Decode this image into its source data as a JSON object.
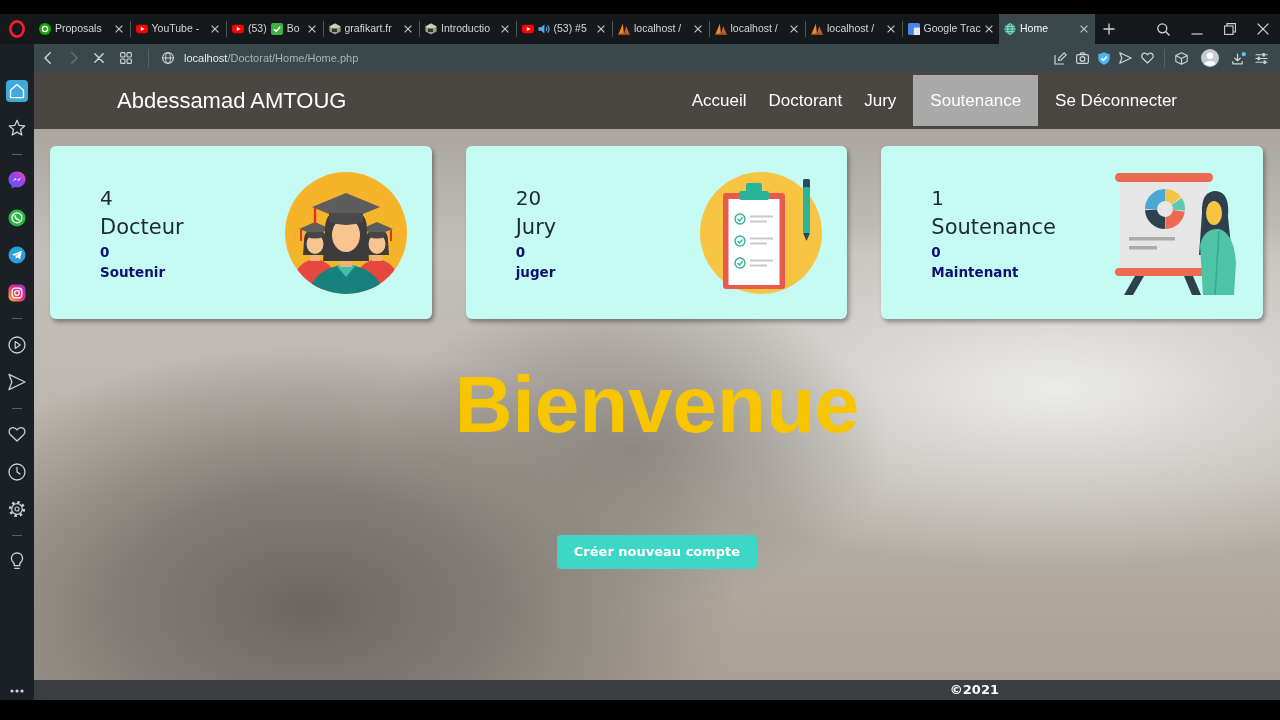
{
  "tabs": [
    {
      "title": "Proposals",
      "kind": "up-circle",
      "audio": false,
      "selected": false
    },
    {
      "title": "YouTube -",
      "kind": "play",
      "audio": false,
      "selected": false
    },
    {
      "title": "(53)",
      "emoji": {
        "kind": "check"
      },
      "title_end": "Bo",
      "kind": "play",
      "audio": false,
      "selected": false
    },
    {
      "title": "grafikart.fr",
      "kind": "cube",
      "audio": false,
      "selected": false
    },
    {
      "title": "Introductio",
      "kind": "cube",
      "audio": false,
      "selected": false
    },
    {
      "title": "(53) #5",
      "kind": "play",
      "audio": true,
      "selected": false
    },
    {
      "title": "localhost /",
      "kind": "sail",
      "audio": false,
      "selected": false
    },
    {
      "title": "localhost /",
      "kind": "sail",
      "audio": false,
      "selected": false
    },
    {
      "title": "localhost /",
      "kind": "sail",
      "audio": false,
      "selected": false
    },
    {
      "title": "Google Trac",
      "kind": "document",
      "audio": false,
      "selected": false
    },
    {
      "title": "Home",
      "kind": "globe",
      "audio": false,
      "selected": true
    }
  ],
  "address_bar": {
    "back": {
      "disabled": false
    },
    "forward": {
      "disabled": true
    },
    "url": {
      "host": "localhost",
      "path": "/Doctorat/Home/Home.php"
    }
  },
  "sidebar": {
    "groups": [
      {
        "items": [
          {
            "kind": "home",
            "selected": true
          },
          {
            "kind": "star",
            "selected": false
          }
        ]
      },
      {
        "items": [
          {
            "kind": "chat-bubble",
            "selected": false
          },
          {
            "kind": "phone-bubble",
            "selected": false
          },
          {
            "kind": "paper-plane",
            "selected": false
          },
          {
            "kind": "camera",
            "selected": false
          }
        ]
      },
      {
        "items": [
          {
            "kind": "play",
            "selected": false
          },
          {
            "kind": "send",
            "selected": false
          }
        ]
      },
      {
        "items": [
          {
            "kind": "heart",
            "selected": false
          },
          {
            "kind": "clock",
            "selected": false
          },
          {
            "kind": "gear",
            "selected": false
          }
        ]
      },
      {
        "items": [
          {
            "kind": "lightbulb",
            "selected": false
          }
        ]
      }
    ]
  },
  "navbar": {
    "brand": "Abdessamad AMTOUG",
    "links": [
      {
        "label": "Accueil",
        "selected": false
      },
      {
        "label": "Doctorant",
        "selected": false
      },
      {
        "label": "Jury",
        "selected": false
      },
      {
        "label": "Soutenance",
        "selected": true
      },
      {
        "label": "Se Déconnecter",
        "selected": false
      }
    ]
  },
  "cards": [
    {
      "count": "4",
      "label": "Docteur",
      "sub_count": "0",
      "sub_label": "Soutenir",
      "kind": "graduates"
    },
    {
      "count": "20",
      "label": "Jury",
      "sub_count": "0",
      "sub_label": "juger",
      "kind": "clipboard"
    },
    {
      "count": "1",
      "label": "Soutenance",
      "sub_count": "0",
      "sub_label": "Maintenant",
      "kind": "presentation"
    }
  ],
  "hero": {
    "title": "Bienvenue",
    "button": "Créer nouveau compte"
  },
  "footer": {
    "text": "©2021"
  }
}
